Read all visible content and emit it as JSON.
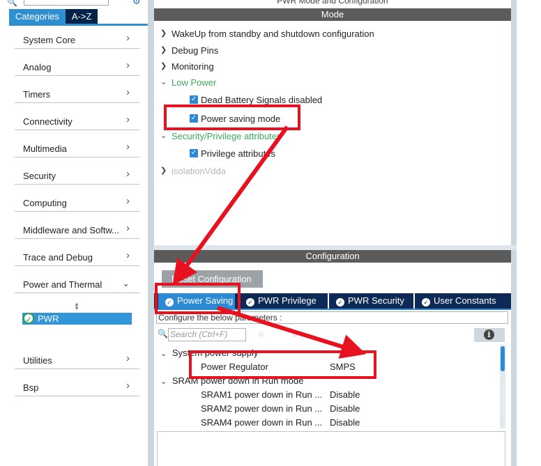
{
  "left": {
    "tabs": [
      {
        "label": "Categories",
        "active": true
      },
      {
        "label": "A->Z",
        "active": false
      }
    ],
    "categories": [
      {
        "label": "System Core",
        "expanded": false
      },
      {
        "label": "Analog",
        "expanded": false
      },
      {
        "label": "Timers",
        "expanded": false
      },
      {
        "label": "Connectivity",
        "expanded": false
      },
      {
        "label": "Multimedia",
        "expanded": false
      },
      {
        "label": "Security",
        "expanded": false
      },
      {
        "label": "Computing",
        "expanded": false
      },
      {
        "label": "Middleware and Softw...",
        "expanded": false
      },
      {
        "label": "Trace and Debug",
        "expanded": false
      },
      {
        "label": "Power and Thermal",
        "expanded": true
      }
    ],
    "selected_peripheral": "PWR",
    "more_categories": [
      {
        "label": "Utilities"
      },
      {
        "label": "Bsp"
      }
    ]
  },
  "mode": {
    "window_title": "PWR Mode and Configuration",
    "header": "Mode",
    "items": [
      {
        "label": "WakeUp from standby and shutdown configuration",
        "state": "collapsed"
      },
      {
        "label": "Debug Pins",
        "state": "collapsed"
      },
      {
        "label": "Monitoring",
        "state": "collapsed"
      },
      {
        "label": "Low Power",
        "state": "expanded"
      },
      {
        "label": "Dead Battery Signals disabled",
        "checked": true
      },
      {
        "label": "Power saving mode",
        "checked": true
      },
      {
        "label": "Security/Privilege attributes",
        "state": "expanded"
      },
      {
        "label": "Privilege attributes",
        "checked": true
      },
      {
        "label": "isolationVdda",
        "state": "disabled"
      }
    ]
  },
  "config": {
    "header": "Configuration",
    "reset_label": "Reset Configuration",
    "tabs": [
      {
        "label": "Power Saving",
        "active": true
      },
      {
        "label": "PWR Privilege",
        "active": false
      },
      {
        "label": "PWR Security",
        "active": false
      },
      {
        "label": "User Constants",
        "active": false
      }
    ],
    "params_hint": "Configure the below parameters :",
    "search_placeholder": "Search (Ctrl+F)",
    "groups": [
      {
        "label": "System power supply",
        "params": [
          {
            "name": "Power Regulator",
            "value": "SMPS"
          }
        ]
      },
      {
        "label": "SRAM power down in Run mode",
        "params": [
          {
            "name": "SRAM1 power down in Run ...",
            "value": "Disable"
          },
          {
            "name": "SRAM2 power down in Run ...",
            "value": "Disable"
          },
          {
            "name": "SRAM4 power down in Run ...",
            "value": "Disable"
          }
        ]
      }
    ]
  },
  "colors": {
    "annotation_red": "#e8111f",
    "tab_active_blue": "#2b8ad3",
    "tab_bar_navy": "#0c2a55",
    "green_section": "#3aaa5a"
  }
}
